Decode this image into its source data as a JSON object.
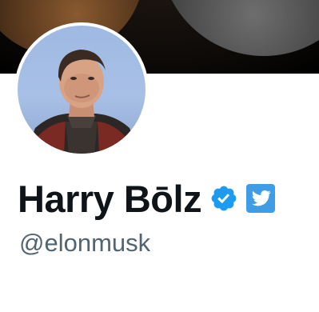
{
  "profile": {
    "display_name": "Harry Bōlz",
    "handle": "@elonmusk",
    "verified_icon": "verified-badge-icon",
    "affiliate_icon": "twitter-bird-icon",
    "avatar_icon": "profile-avatar"
  },
  "colors": {
    "name_text": "#0f1419",
    "handle_text": "#536471",
    "verified_blue": "#1d9bf0",
    "badge_blue": "#3f9de6"
  }
}
